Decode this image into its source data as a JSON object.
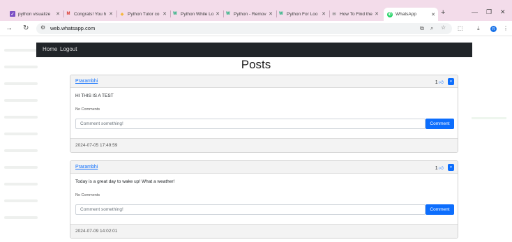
{
  "browser": {
    "tabs": [
      {
        "title": "python visualize",
        "favicon": "gh-icon",
        "color": "#7b4fc4"
      },
      {
        "title": "Congrats! You h",
        "favicon": "gmail-icon",
        "color": "#d93025"
      },
      {
        "title": "Python Tutor co",
        "favicon": "pythontutor-icon",
        "color": "#f6b73c"
      },
      {
        "title": "Python While Lo",
        "favicon": "w3-icon",
        "color": "#04aa6d"
      },
      {
        "title": "Python - Remov",
        "favicon": "w3-icon",
        "color": "#04aa6d"
      },
      {
        "title": "Python For Loo",
        "favicon": "w3-icon",
        "color": "#04aa6d"
      },
      {
        "title": "How To Find the",
        "favicon": "mail-icon",
        "color": "#8a8a8a"
      },
      {
        "title": "WhatsApp",
        "favicon": "whatsapp-icon",
        "color": "#25d366"
      }
    ],
    "url": "web.whatsapp.com",
    "profile_initial": "R"
  },
  "nav": {
    "home": "Home",
    "logout": "Logout"
  },
  "page_title": "Posts",
  "posts": [
    {
      "author": "Prarambhi",
      "likes": "1",
      "content": "HI THIS IS A TEST",
      "comments_text": "No Comments",
      "comment_placeholder": "Comment something!",
      "comment_button": "Comment",
      "date": "2024-07-05 17:49:59"
    },
    {
      "author": "Prarambhi",
      "likes": "1",
      "content": "Today is a great day to wake up! What a weather!",
      "comments_text": "No Comments",
      "comment_placeholder": "Comment something!",
      "comment_button": "Comment",
      "date": "2024-07-09 14:02:01"
    }
  ],
  "colors": {
    "primary": "#0d6efd",
    "navbar": "#212529",
    "tabstrip": "#f3dcea"
  }
}
